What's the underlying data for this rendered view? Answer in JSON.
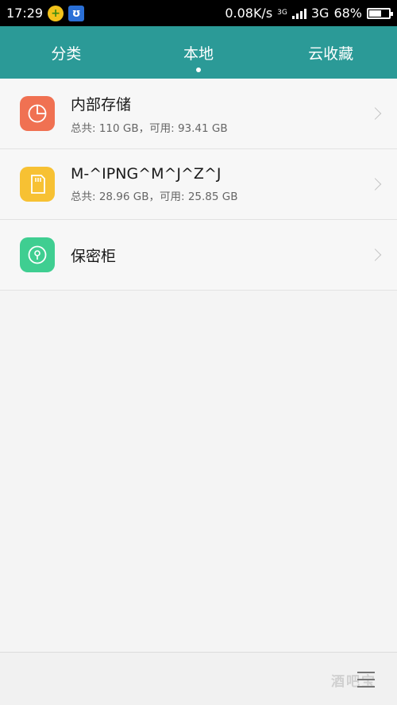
{
  "status_bar": {
    "time": "17:29",
    "net_speed": "0.08K/s",
    "net_type_small": "3G",
    "net_type": "3G",
    "battery": "68%",
    "battery_level": 0.68
  },
  "tabs": [
    {
      "label": "分类",
      "active": false
    },
    {
      "label": "本地",
      "active": true
    },
    {
      "label": "云收藏",
      "active": false
    }
  ],
  "storage_items": [
    {
      "title": "内部存储",
      "subtitle": "总共: 110 GB，可用: 93.41 GB",
      "icon": "pie-chart-icon",
      "color": "#f07152"
    },
    {
      "title": "M-^IPNG^M^J^Z^J",
      "subtitle": "总共: 28.96 GB，可用: 25.85 GB",
      "icon": "sd-card-icon",
      "color": "#f7c133"
    },
    {
      "title": "保密柜",
      "subtitle": "",
      "icon": "lock-icon",
      "color": "#3fce91"
    }
  ],
  "bottom_bar": {
    "watermark": "酒吧宝",
    "menu_icon": "menu-icon"
  },
  "colors": {
    "header": "#2b9a97",
    "background": "#f4f4f4"
  }
}
